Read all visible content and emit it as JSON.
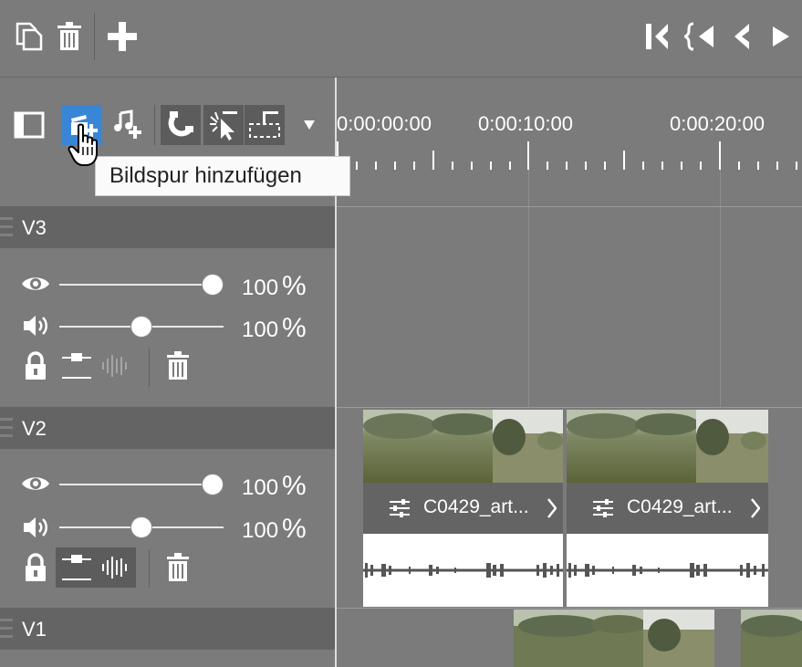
{
  "tooltip": {
    "text": "Bildspur hinzufügen"
  },
  "ruler": {
    "timecodes": [
      "0:00:00:00",
      "0:00:10:00",
      "0:00:20:00"
    ]
  },
  "tracks": [
    {
      "name": "V3",
      "opacity": "100",
      "volume": "100",
      "unit": "%",
      "opacity_level": 1.0,
      "volume_level": 0.5,
      "locked": true,
      "has_audio_mix_active": false
    },
    {
      "name": "V2",
      "opacity": "100",
      "volume": "100",
      "unit": "%",
      "opacity_level": 1.0,
      "volume_level": 0.5,
      "locked": true,
      "has_audio_mix_active": true
    },
    {
      "name": "V1"
    }
  ],
  "clips": [
    {
      "label": "C0429_art..."
    },
    {
      "label": "C0429_art..."
    }
  ],
  "colors": {
    "background": "#7b7b7b",
    "track_header": "#646464",
    "active_tool": "#3a86d6",
    "dark_tool": "#5c5c5c"
  },
  "icons": {
    "top_toolbar": [
      "copy-icon",
      "trash-icon",
      "plus-icon",
      "go-to-start-icon",
      "previous-marker-icon",
      "previous-frame-icon",
      "play-icon"
    ],
    "tools": [
      "panel-toggle-icon",
      "add-video-track-icon",
      "add-audio-track-icon",
      "magnet-icon",
      "selection-tool-icon",
      "trim-tool-icon",
      "more-dropdown-icon"
    ]
  }
}
